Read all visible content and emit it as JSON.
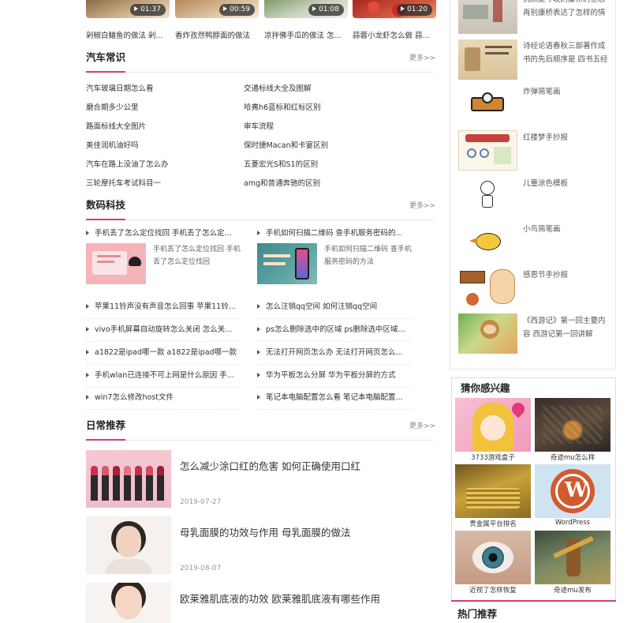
{
  "videos": [
    {
      "caption": "剁椒白鳝鱼的做法 剁...",
      "duration": "01:37",
      "colors": [
        "#a98656",
        "#e2d2b8"
      ]
    },
    {
      "caption": "香炸孜然鸭脖面的做法",
      "duration": "00:59",
      "colors": [
        "#c69a6c",
        "#f1e4d4"
      ]
    },
    {
      "caption": "凉拌佛手瓜的做法 怎...",
      "duration": "01:08",
      "colors": [
        "#b7c7a6",
        "#e6e9df"
      ]
    },
    {
      "caption": "蒜蓉小龙虾怎么做 蒜...",
      "duration": "01:20",
      "colors": [
        "#c2322a",
        "#e27a5b"
      ]
    }
  ],
  "auto_knowledge": {
    "title": "汽车常识",
    "more": "更多>>",
    "left": [
      "汽车玻璃日期怎么看",
      "磨合期多少公里",
      "路面标线大全图片",
      "美佳润机油好吗",
      "汽车在路上没油了怎么办",
      "三轮摩托车考试科目一"
    ],
    "right": [
      "交通标线大全及图解",
      "哈弗h6蓝标和红标区别",
      "审车流程",
      "保时捷Macan和卡宴区别",
      "五菱宏光S和S1的区别",
      "amg和普通奔驰的区别"
    ]
  },
  "digital_tech": {
    "title": "数码科技",
    "more": "更多>>",
    "featured": [
      {
        "headline": "手机丢了怎么定位找回 手机丢了怎么定...",
        "summary": "手机丢了怎么定位找回 手机丢了怎么定位找回"
      },
      {
        "headline": "手机如何扫描二维码 查手机服务密码的...",
        "summary": "手机如何扫描二维码 查手机服务密码的方法"
      }
    ],
    "left": [
      "苹果11铃声没有声音怎么回事 苹果11铃...",
      "vivo手机屏幕自动旋转怎么关闭 怎么关...",
      "a1822是ipad哪一款 a1822是ipad哪一款",
      "手机wlan已连接不可上网是什么原因 手...",
      "win7怎么修改host文件"
    ],
    "right": [
      "怎么注销qq空间 如何注销qq空间",
      "ps怎么删除选中的区域 ps删除选中区域...",
      "无法打开网页怎么办 无法打开网页怎么...",
      "华为平板怎么分屏 华为平板分屏的方式",
      "笔记本电脑配置怎么看 笔记本电脑配置..."
    ]
  },
  "daily": {
    "title": "日常推荐",
    "more": "更多>>",
    "items": [
      {
        "title": "怎么减少涂口红的危害 如何正确使用口红",
        "date": "2019-07-27"
      },
      {
        "title": "母乳面膜的功效与作用 母乳面膜的做法",
        "date": "2019-08-07"
      },
      {
        "title": "欧莱雅肌底液的功效 欧莱雅肌底液有哪些作用",
        "date": ""
      }
    ]
  },
  "sidebar_list": [
    "沉默是今晚的康桥的意思 再别康桥表达了怎样的情",
    "诗经论语春秋三部著作成书的先后顺序是 四书五经",
    "炸弹简笔画",
    "红楼梦手抄报",
    "儿童涂色模板",
    "小鸟简笔画",
    "感恩节手抄报",
    "《西游记》第一回主要内容 西游记第一回讲解"
  ],
  "guess": {
    "title": "猜你感兴趣",
    "items": [
      "3733游戏盒子",
      "奇迹mu怎么样",
      "贵金属平台排名",
      "WordPress",
      "近视了怎样恢复",
      "奇迹mu发布"
    ]
  },
  "hot": {
    "title": "热门推荐"
  },
  "theme": {
    "accent": "#d63a7f",
    "more_color": "#888888"
  }
}
